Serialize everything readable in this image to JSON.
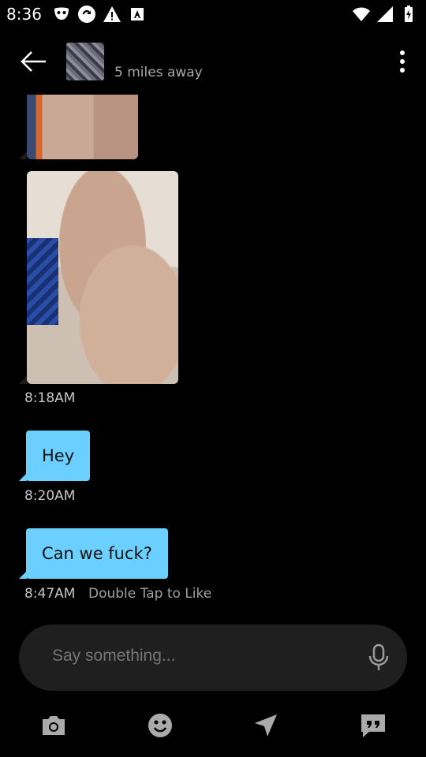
{
  "status_bar": {
    "time": "8:36",
    "left_icons": [
      "grindr-mask-icon",
      "sync-icon",
      "warning-icon",
      "a-box-icon"
    ],
    "right_icons": [
      "wifi-icon",
      "signal-icon",
      "battery-icon"
    ]
  },
  "header": {
    "distance": "5 miles away",
    "avatar": "profile-photo"
  },
  "messages": [
    {
      "type": "photo",
      "id": "photo-1"
    },
    {
      "type": "photo",
      "id": "photo-2",
      "time": "8:18AM"
    },
    {
      "type": "text",
      "text": "Hey",
      "time": "8:20AM"
    },
    {
      "type": "text",
      "text": "Can we fuck?",
      "time": "8:47AM",
      "hint": "Double Tap to Like"
    }
  ],
  "composer": {
    "placeholder": "Say something..."
  },
  "toolbar": {
    "icons": [
      "camera-icon",
      "emoji-icon",
      "location-icon",
      "saved-phrases-icon"
    ]
  },
  "colors": {
    "background": "#000000",
    "bubble": "#6bd0ff",
    "input_bg": "#1f1f1f",
    "muted_text": "#a8a8a8"
  }
}
